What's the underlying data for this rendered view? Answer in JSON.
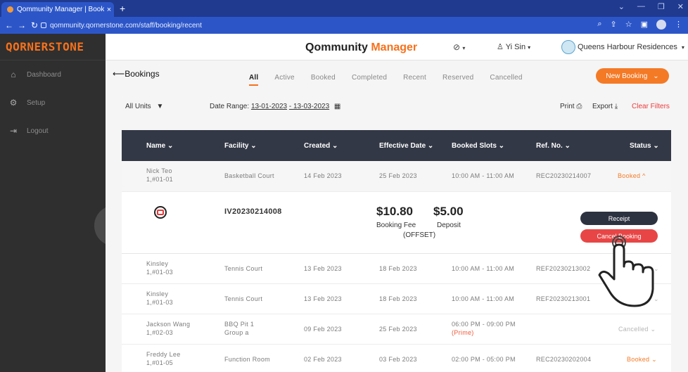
{
  "browser": {
    "tab_title": "Qommunity Manager | Bookings",
    "url": "qommunity.qornerstone.com/staff/booking/recent"
  },
  "sidebar": {
    "brand": "QORNERSTONE",
    "items": [
      {
        "label": "Dashboard",
        "icon": "home-icon"
      },
      {
        "label": "Setup",
        "icon": "gear-icon"
      },
      {
        "label": "Logout",
        "icon": "logout-icon"
      }
    ]
  },
  "header": {
    "title_main": "Qommunity",
    "title_accent": "Manager",
    "user": "Yi Sin",
    "estate": "Queens Harbour Residences"
  },
  "page": {
    "back_label": "Bookings",
    "tabs": [
      "All",
      "Active",
      "Booked",
      "Completed",
      "Recent",
      "Reserved",
      "Cancelled"
    ],
    "active_tab": "All",
    "new_booking_label": "New Booking"
  },
  "filters": {
    "units_label": "All Units",
    "date_range_label": "Date Range:",
    "date_from": "13-01-2023",
    "date_to": "13-03-2023",
    "print_label": "Print",
    "export_label": "Export",
    "clear_label": "Clear Filters"
  },
  "table": {
    "columns": [
      "Name",
      "Facility",
      "Created",
      "Effective Date",
      "Booked Slots",
      "Ref. No.",
      "Status"
    ],
    "rows": [
      {
        "name": "Nick Teo",
        "unit": "1,#01-01",
        "facility": "Basketball Court",
        "facility_sub": "",
        "created": "14 Feb 2023",
        "effective": "25 Feb 2023",
        "slots": "10:00 AM - 11:00 AM",
        "slots_note": "",
        "ref": "REC20230214007",
        "status": "Booked"
      },
      {
        "name": "Kinsley",
        "unit": "1,#01-03",
        "facility": "Tennis Court",
        "facility_sub": "",
        "created": "13 Feb 2023",
        "effective": "18 Feb 2023",
        "slots": "10:00 AM - 11:00 AM",
        "slots_note": "",
        "ref": "REF20230213002",
        "status": ""
      },
      {
        "name": "Kinsley",
        "unit": "1,#01-03",
        "facility": "Tennis Court",
        "facility_sub": "",
        "created": "13 Feb 2023",
        "effective": "18 Feb 2023",
        "slots": "10:00 AM - 11:00 AM",
        "slots_note": "",
        "ref": "REF20230213001",
        "status": ""
      },
      {
        "name": "Jackson Wang",
        "unit": "1,#02-03",
        "facility": "BBQ Pit 1",
        "facility_sub": "Group a",
        "created": "09 Feb 2023",
        "effective": "25 Feb 2023",
        "slots": "06:00 PM - 09:00 PM",
        "slots_note": "(Prime)",
        "ref": "",
        "status": "Cancelled"
      },
      {
        "name": "Freddy Lee",
        "unit": "1,#01-05",
        "facility": "Function Room",
        "facility_sub": "",
        "created": "02 Feb 2023",
        "effective": "03 Feb 2023",
        "slots": "02:00 PM - 05:00 PM",
        "slots_note": "",
        "ref": "REC20230202004",
        "status": "Booked"
      }
    ],
    "expanded": {
      "invoice_no": "IV20230214008",
      "booking_fee": "$10.80",
      "booking_fee_label": "Booking Fee",
      "deposit": "$5.00",
      "deposit_label": "Deposit",
      "offset_label": "(OFFSET)",
      "receipt_label": "Receipt",
      "cancel_label": "Cancel Booking"
    }
  }
}
